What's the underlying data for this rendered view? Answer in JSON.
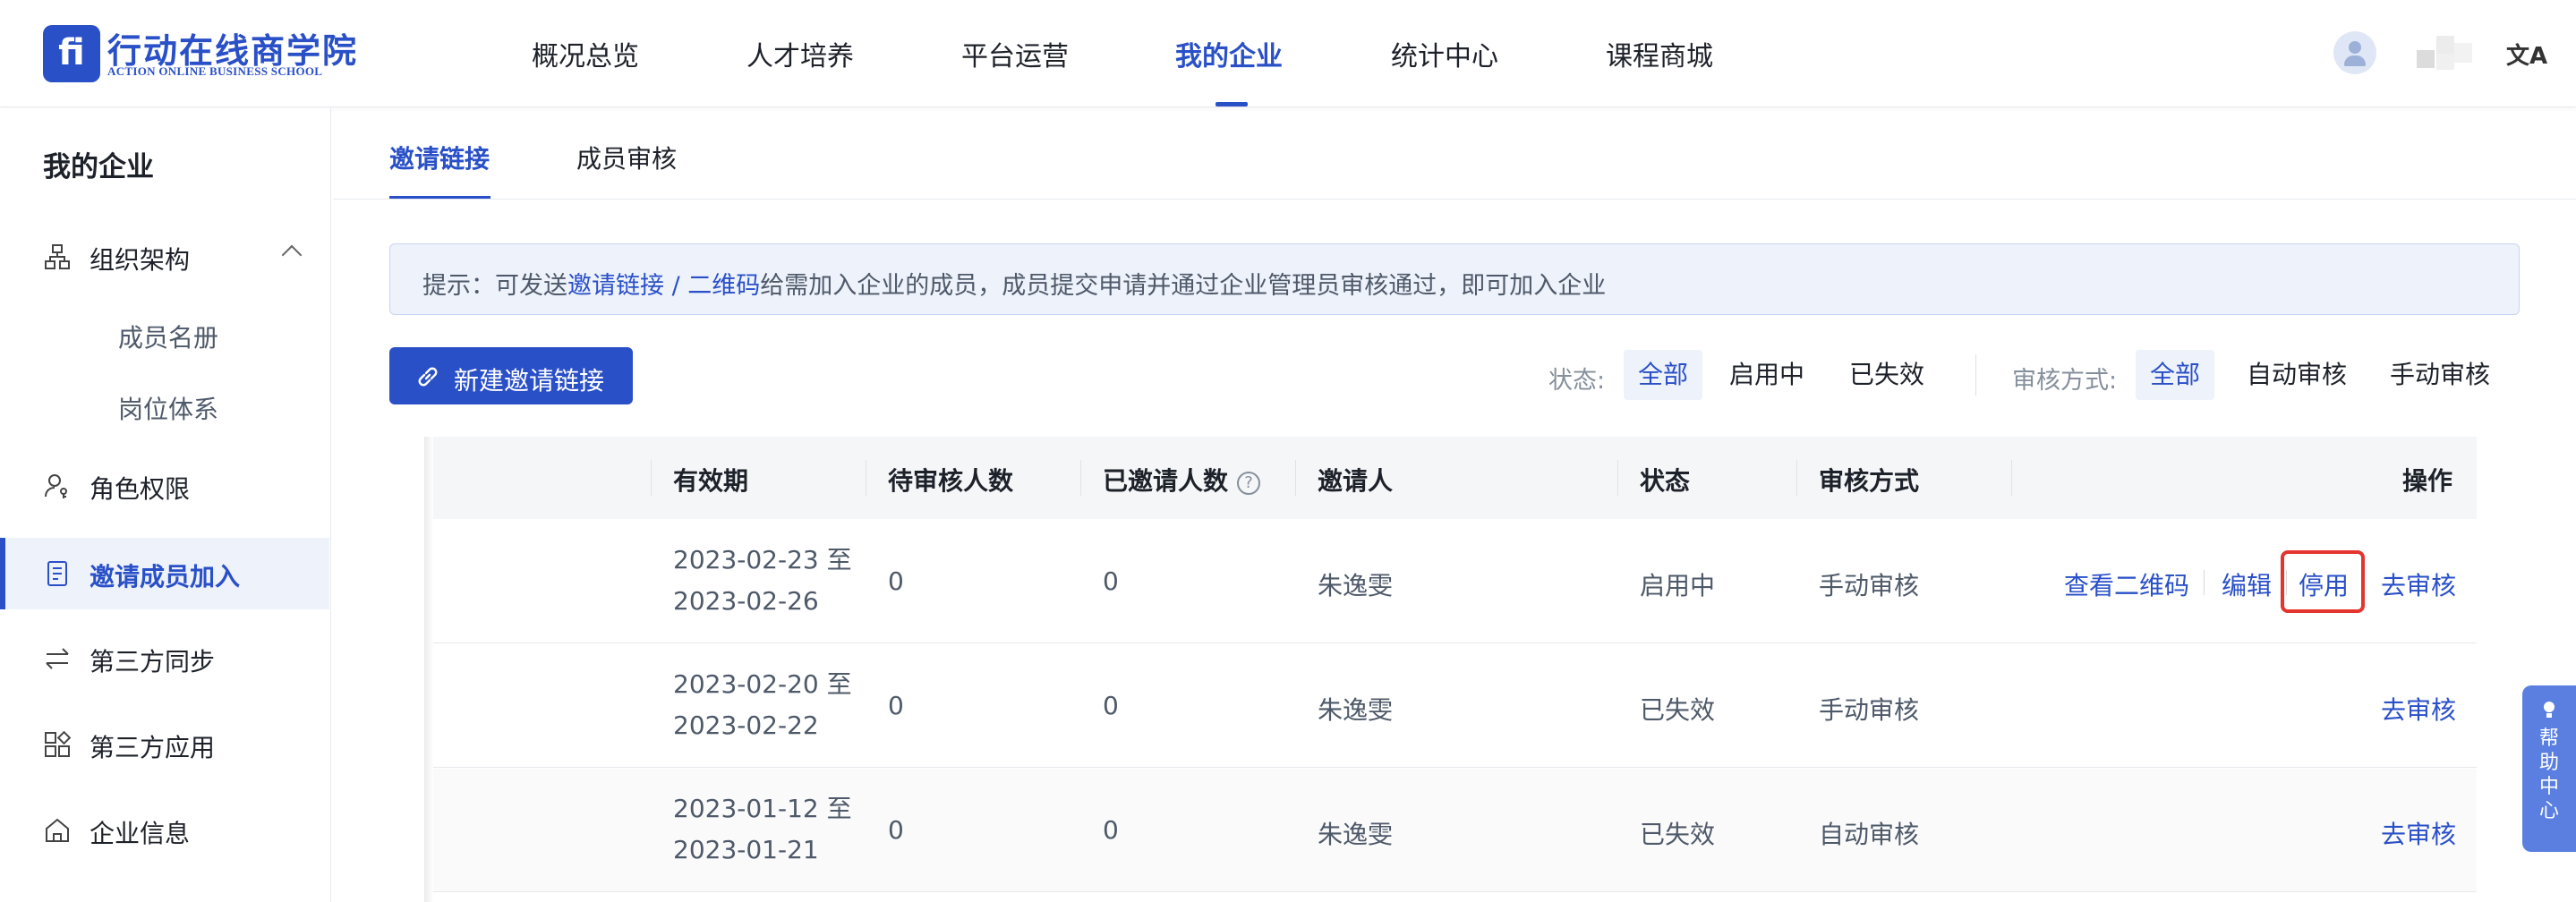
{
  "brand": {
    "mark": "fi",
    "name_cn": "行动在线商学院",
    "name_en": "ACTION ONLINE BUSINESS SCHOOL"
  },
  "top_nav": [
    "概况总览",
    "人才培养",
    "平台运营",
    "我的企业",
    "统计中心",
    "课程商城"
  ],
  "top_nav_active": "我的企业",
  "lang_icon": "文A",
  "sidebar": {
    "title": "我的企业",
    "items": [
      {
        "label": "组织架构",
        "icon": "org-chart-icon",
        "expanded": true
      },
      {
        "label": "成员名册",
        "sub": true
      },
      {
        "label": "岗位体系",
        "sub": true
      },
      {
        "label": "角色权限",
        "icon": "user-key-icon"
      },
      {
        "label": "邀请成员加入",
        "icon": "document-icon",
        "active": true
      },
      {
        "label": "第三方同步",
        "icon": "sync-arrows-icon"
      },
      {
        "label": "第三方应用",
        "icon": "apps-icon"
      },
      {
        "label": "企业信息",
        "icon": "home-icon"
      }
    ]
  },
  "tabs": [
    "邀请链接",
    "成员审核"
  ],
  "tip": {
    "prefix": "提示：可发送",
    "link": "邀请链接 / 二维码",
    "suffix": "给需加入企业的成员，成员提交申请并通过企业管理员审核通过，即可加入企业"
  },
  "new_button": "新建邀请链接",
  "filters": {
    "status_label": "状态:",
    "status_options": [
      "全部",
      "启用中",
      "已失效"
    ],
    "review_label": "审核方式:",
    "review_options": [
      "全部",
      "自动审核",
      "手动审核"
    ]
  },
  "table": {
    "headers": [
      "有效期",
      "待审核人数",
      "已邀请人数",
      "邀请人",
      "状态",
      "审核方式",
      "操作"
    ],
    "rows": [
      {
        "valid_from": "2023-02-23 至",
        "valid_to": "2023-02-26",
        "pending": "0",
        "invited": "0",
        "inviter": "朱逸雯",
        "status": "启用中",
        "review": "手动审核",
        "ops": [
          "查看二维码",
          "编辑",
          "停用",
          "去审核"
        ]
      },
      {
        "valid_from": "2023-02-20 至",
        "valid_to": "2023-02-22",
        "pending": "0",
        "invited": "0",
        "inviter": "朱逸雯",
        "status": "已失效",
        "review": "手动审核",
        "ops": [
          "去审核"
        ]
      },
      {
        "valid_from": "2023-01-12 至",
        "valid_to": "2023-01-21",
        "pending": "0",
        "invited": "0",
        "inviter": "朱逸雯",
        "status": "已失效",
        "review": "自动审核",
        "ops": [
          "去审核"
        ]
      }
    ]
  },
  "help_center": "帮助中心",
  "colors": {
    "primary": "#2a50c8",
    "highlight_box": "#e3342f",
    "help_float": "#5a7fe0"
  }
}
